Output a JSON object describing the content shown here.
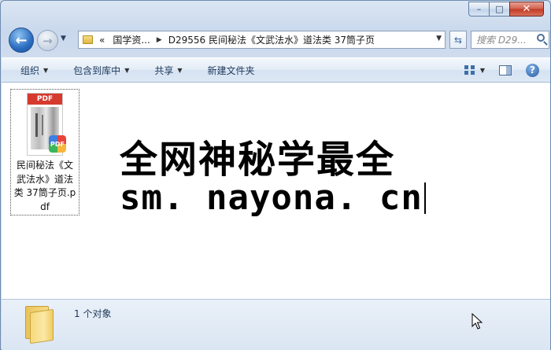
{
  "nav": {
    "breadcrumb_overflow": "«",
    "breadcrumbs": [
      "国学资...",
      "D29556 民间秘法《文武法水》道法类 37筒子页"
    ],
    "search_placeholder": "搜索 D29..."
  },
  "toolbar": {
    "organize": "组织",
    "include_in_library": "包含到库中",
    "share": "共享",
    "new_folder": "新建文件夹"
  },
  "file": {
    "thumb_label": "PDF",
    "badge": "PDF",
    "name": "民间秘法《文武法水》道法类 37筒子页.pdf"
  },
  "banner": {
    "line1": "全网神秘学最全",
    "line2": "sm. nayona. cn"
  },
  "details": {
    "status": "1 个对象"
  },
  "colors": {
    "close_button": "#c23a24",
    "pdf_band": "#d63a2e",
    "window_frame": "#cfdcee"
  }
}
